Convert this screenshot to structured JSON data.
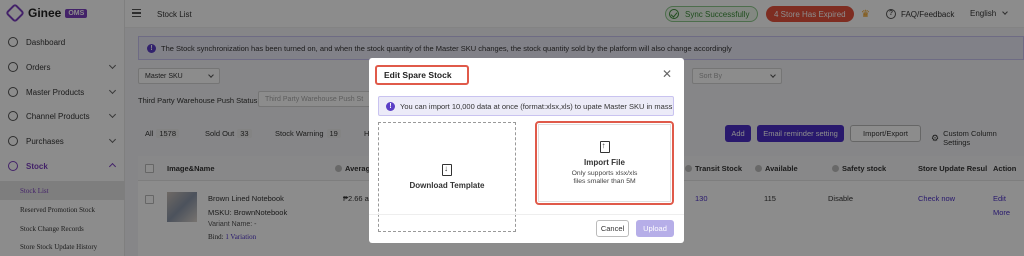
{
  "app": {
    "logo_text": "Ginee",
    "logo_badge": "OMS"
  },
  "sidebar": {
    "items": [
      {
        "label": "Dashboard"
      },
      {
        "label": "Orders"
      },
      {
        "label": "Master Products"
      },
      {
        "label": "Channel Products"
      },
      {
        "label": "Purchases"
      },
      {
        "label": "Stock"
      }
    ],
    "sub_items": [
      {
        "label": "Stock List"
      },
      {
        "label": "Reserved Promotion Stock"
      },
      {
        "label": "Stock Change Records"
      },
      {
        "label": "Store Stock Update History"
      }
    ]
  },
  "header": {
    "page_title": "Stock List",
    "sync_status": "Sync Successfully",
    "expired": "4 Store Has Expired",
    "faq": "FAQ/Feedback",
    "language": "English"
  },
  "notice": {
    "text": "The Stock synchronization has been turned on, and when the stock quantity of the Master SKU changes, the stock quantity sold by the platform will also change accordingly"
  },
  "filters": {
    "master_sku": "Master SKU",
    "sort_by": "Sort By",
    "push_status_label": "Third Party Warehouse Push Status :",
    "push_status_placeholder": "Third Party Warehouse Push St"
  },
  "tabs": {
    "all_label": "All",
    "all_count": "1578",
    "sold_out_label": "Sold Out",
    "sold_out_count": "33",
    "warning_label": "Stock Warning",
    "warning_count": "19",
    "more_label": "H"
  },
  "toolbar": {
    "add": "Add",
    "email_reminder": "Email reminder setting",
    "import_export": "Import/Export",
    "custom_columns": "Custom Column Settings"
  },
  "table": {
    "headers": {
      "image_name": "Image&Name",
      "average": "Averag",
      "transit": "Transit Stock",
      "available": "Available",
      "safety": "Safety stock",
      "store_update": "Store Update Resul",
      "action": "Action"
    },
    "row": {
      "name": "Brown Lined Notebook",
      "msku_label": "MSKU:",
      "msku_value": "BrownNotebook",
      "variant": "Variant Name: -",
      "bind_label": "Bind:",
      "bind_value": "1 Variation",
      "price": "₱2.66 a",
      "transit": "130",
      "available": "115",
      "safety": "Disable",
      "store_update": "Check now",
      "action_edit": "Edit",
      "action_more": "More"
    }
  },
  "modal": {
    "title": "Edit Spare Stock",
    "info": "You can import 10,000 data at once (format:xlsx,xls) to upate Master SKU in mass",
    "download_template": "Download Template",
    "import_file": "Import File",
    "import_hint_1": "Only supports xlsx/xls",
    "import_hint_2": "files smaller than 5M",
    "cancel": "Cancel",
    "upload": "Upload"
  },
  "colors": {
    "accent": "#4b2fc7",
    "brand": "#7b3fbf",
    "highlight": "#e05a4a",
    "sync_green": "#3a8d36"
  },
  "icons": [
    "dashboard-icon",
    "orders-icon",
    "master-products-icon",
    "channel-products-icon",
    "purchases-icon",
    "stock-icon",
    "close-icon",
    "download-icon",
    "upload-icon",
    "info-icon",
    "sync-check-icon",
    "crown-icon",
    "help-icon",
    "gear-icon"
  ]
}
